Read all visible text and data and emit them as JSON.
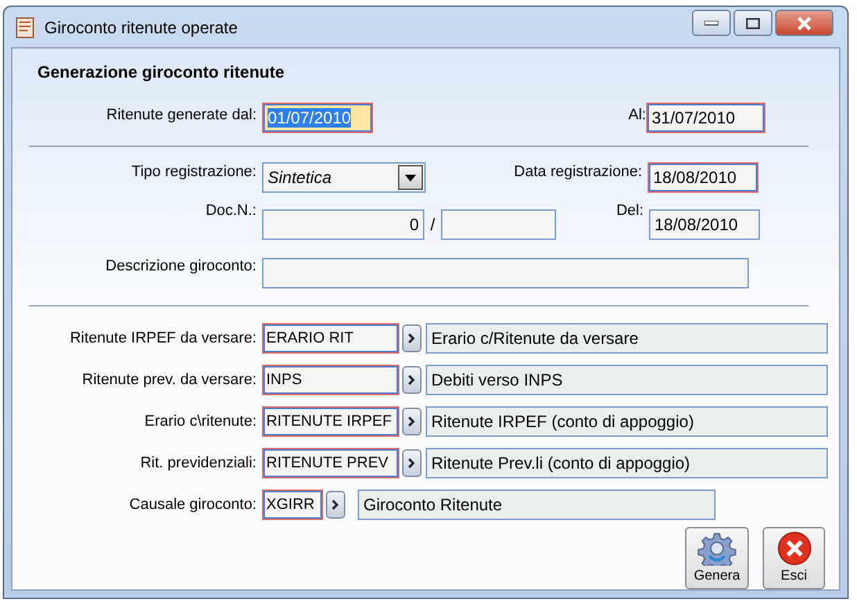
{
  "window": {
    "title": "Giroconto ritenute operate"
  },
  "heading": "Generazione giroconto ritenute",
  "period": {
    "from": {
      "label": "Ritenute generate dal:",
      "value": "01/07/2010",
      "required": true,
      "focused": true
    },
    "to": {
      "label": "Al:",
      "value": "31/07/2010",
      "required": true,
      "focused": false
    }
  },
  "registration": {
    "type": {
      "label": "Tipo registrazione:",
      "value": "Sintetica"
    },
    "date": {
      "label": "Data registrazione:",
      "value": "18/08/2010",
      "required": true
    }
  },
  "document": {
    "label": "Doc.N.:",
    "number": "0",
    "separator": "/",
    "date_label": "Del:",
    "date": "18/08/2010"
  },
  "description": {
    "label": "Descrizione giroconto:"
  },
  "accounts": [
    {
      "label": "Ritenute IRPEF da versare:",
      "code": "ERARIO RIT",
      "description": "Erario c/Ritenute da versare",
      "required": true
    },
    {
      "label": "Ritenute prev. da versare:",
      "code": "INPS",
      "description": "Debiti verso INPS",
      "required": true
    },
    {
      "label": "Erario c\\ritenute:",
      "code": "RITENUTE IRPEF",
      "description": "Ritenute IRPEF (conto di appoggio)",
      "required": true
    },
    {
      "label": "Rit. previdenziali:",
      "code": "RITENUTE PREV",
      "description": "Ritenute Prev.li (conto di appoggio)",
      "required": true
    }
  ],
  "causal": {
    "label": "Causale giroconto:",
    "code": "XGIRR",
    "description": "Giroconto Ritenute",
    "required": true
  },
  "buttons": [
    {
      "kind": "generate",
      "label": "Genera"
    },
    {
      "kind": "exit",
      "label": "Esci"
    }
  ]
}
